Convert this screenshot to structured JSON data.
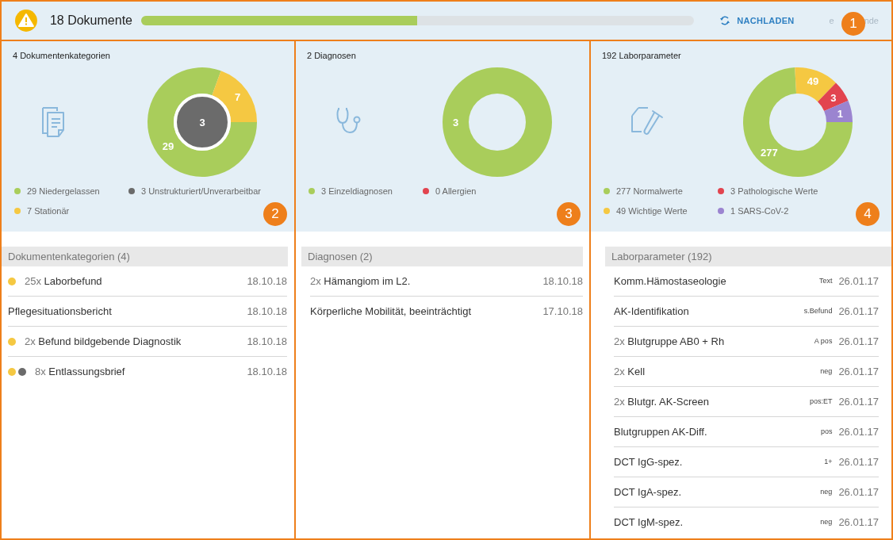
{
  "header": {
    "title": "18 Dokumente",
    "progress": {
      "level": 0.5
    },
    "reload_button": "NACHLADEN",
    "cut_text_start": "e",
    "cut_text_end": "nde"
  },
  "callouts": [
    "1",
    "2",
    "3",
    "4"
  ],
  "panels": [
    {
      "title": "4 Dokumentenkategorien",
      "donut": {
        "segments": [
          {
            "label": "29",
            "color": "#a9cd5b"
          },
          {
            "label": "7",
            "color": "#f5c842"
          }
        ],
        "center": {
          "label": "3",
          "color": "#6b6b6b"
        }
      },
      "legend": [
        {
          "label": "29 Niedergelassen",
          "color": "#a9cd5b"
        },
        {
          "label": "3 Unstrukturiert/Unverarbeitbar",
          "color": "#6b6b6b"
        },
        {
          "label": "7 Stationär",
          "color": "#f5c842"
        }
      ],
      "list": {
        "title": "Dokumentenkategorien (4)",
        "rows": [
          {
            "dots": [
              {
                "color": "#f5c842"
              }
            ],
            "count": "25x",
            "name": "Laborbefund",
            "date": "18.10.18"
          },
          {
            "name": "Pflegesituationsbericht",
            "date": "18.10.18"
          },
          {
            "dots": [
              {
                "color": "#f5c842"
              }
            ],
            "count": "2x",
            "name": "Befund bildgebende Diagnostik",
            "date": "18.10.18"
          },
          {
            "dots": [
              {
                "color": "#f5c842"
              },
              {
                "color": "#6b6b6b"
              }
            ],
            "count": "8x",
            "name": "Entlassungsbrief",
            "date": "18.10.18"
          }
        ]
      }
    },
    {
      "title": "2 Diagnosen",
      "donut": {
        "segments": [
          {
            "label": "3",
            "color": "#a9cd5b"
          }
        ]
      },
      "legend": [
        {
          "label": "3 Einzeldiagnosen",
          "color": "#a9cd5b"
        },
        {
          "label": "0 Allergien",
          "color": "#e2444f"
        }
      ],
      "list": {
        "title": "Diagnosen (2)",
        "rows": [
          {
            "count": "2x",
            "name": "Hämangiom im L2.",
            "date": "18.10.18"
          },
          {
            "name": "Körperliche Mobilität, beeinträchtigt",
            "date": "17.10.18"
          }
        ]
      }
    },
    {
      "title": "192 Laborparameter",
      "donut": {
        "segments": [
          {
            "label": "277",
            "color": "#a9cd5b"
          },
          {
            "label": "49",
            "color": "#f5c842"
          },
          {
            "label": "3",
            "color": "#e2444f"
          },
          {
            "label": "1",
            "color": "#9b84d0"
          }
        ]
      },
      "legend": [
        {
          "label": "277 Normalwerte",
          "color": "#a9cd5b"
        },
        {
          "label": "3 Pathologische Werte",
          "color": "#e2444f"
        },
        {
          "label": "49 Wichtige Werte",
          "color": "#f5c842"
        },
        {
          "label": "1 SARS-CoV-2",
          "color": "#9b84d0"
        }
      ],
      "list": {
        "title": "Laborparameter (192)",
        "rows": [
          {
            "name": "Komm.Hämostaseologie",
            "value": "Text",
            "date": "26.01.17"
          },
          {
            "name": "AK-Identifikation",
            "value": "s.Befund",
            "date": "26.01.17"
          },
          {
            "count": "2x",
            "name": "Blutgruppe AB0 + Rh",
            "value": "A pos",
            "date": "26.01.17"
          },
          {
            "count": "2x",
            "name": "Kell",
            "value": "neg",
            "date": "26.01.17"
          },
          {
            "count": "2x",
            "name": "Blutgr. AK-Screen",
            "value": "pos:ET",
            "date": "26.01.17"
          },
          {
            "name": "Blutgruppen AK-Diff.",
            "value": "pos",
            "date": "26.01.17"
          },
          {
            "name": "DCT IgG-spez.",
            "value": "1+",
            "date": "26.01.17"
          },
          {
            "name": "DCT IgA-spez.",
            "value": "neg",
            "date": "26.01.17"
          },
          {
            "name": "DCT IgM-spez.",
            "value": "neg",
            "date": "26.01.17"
          }
        ]
      }
    }
  ]
}
